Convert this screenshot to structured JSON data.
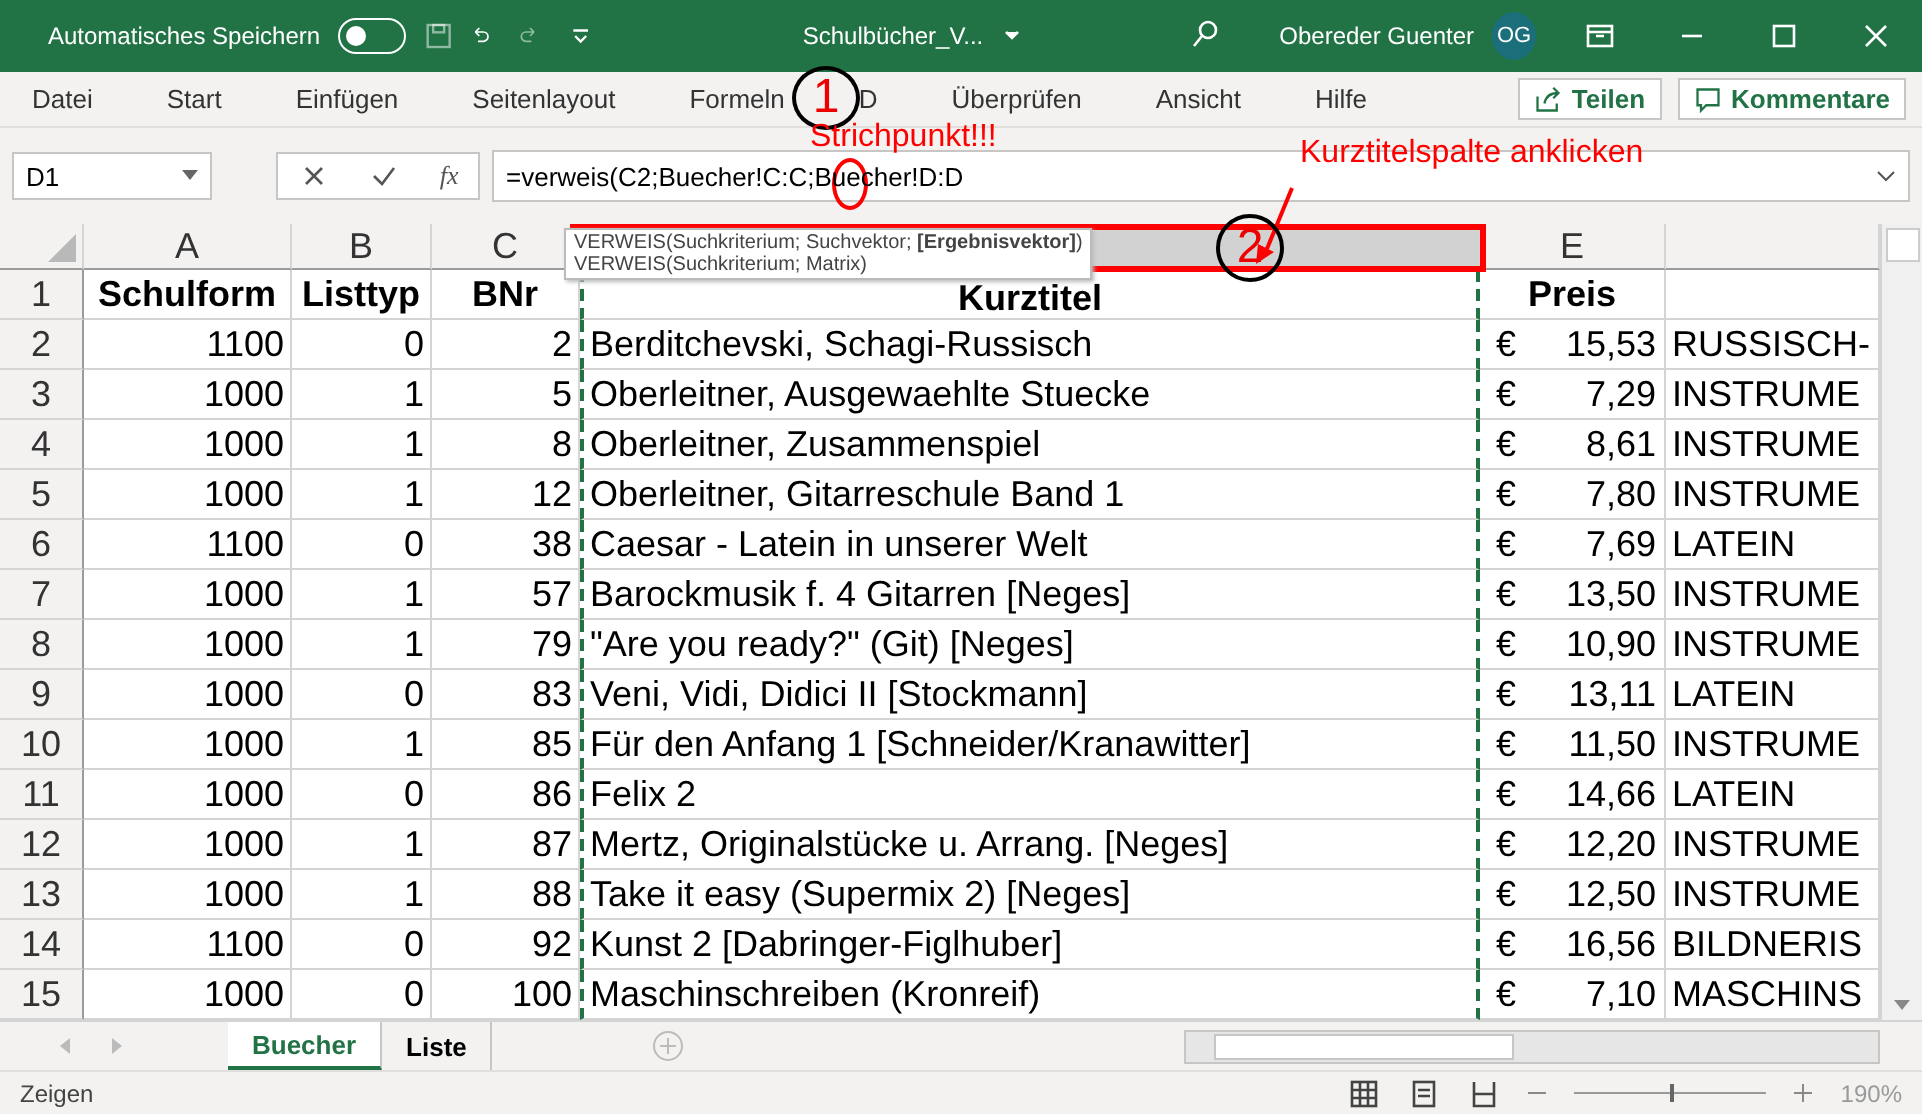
{
  "title_bar": {
    "autosave_label": "Automatisches Speichern",
    "autosave_on": false,
    "file_name": "Schulbücher_V...",
    "user_name": "Obereder Guenter",
    "user_initials": "OG"
  },
  "ribbon_tabs": [
    "Datei",
    "Start",
    "Einfügen",
    "Seitenlayout",
    "Formeln",
    "D",
    "Überprüfen",
    "Ansicht",
    "Hilfe"
  ],
  "ribbon_buttons": [
    "Teilen",
    "Kommentare"
  ],
  "name_box": "D1",
  "function_button": "fx",
  "formula": "=verweis(C2;Buecher!C:C;Buecher!D:D",
  "tooltip": [
    "VERWEIS(Suchkriterium; Suchvektor; **[Ergebnisvektor]**)",
    "VERWEIS(Suchkriterium; Matrix)"
  ],
  "column_headers": [
    {
      "label": "A",
      "selected": false
    },
    {
      "label": "B",
      "selected": false
    },
    {
      "label": "C",
      "selected": false
    },
    {
      "selected": true
    },
    {
      "label": "E",
      "selected": false
    },
    {
      "selected": false
    }
  ],
  "rows": [
    {
      "number": "1",
      "kind": "header",
      "schulform": "Schulform",
      "listtyp": "Listtyp",
      "bnr": "BNr",
      "kurztitel": "Kurztitel",
      "preis": "Preis"
    },
    {
      "number": "2",
      "kind": "data",
      "schulform": "1100",
      "listtyp": "0",
      "bnr": "2",
      "kurztitel": "Berditchevski, Schagi-Russisch",
      "currency": "€",
      "preis": "15,53",
      "fach": "RUSSISCH-"
    },
    {
      "number": "3",
      "kind": "data",
      "schulform": "1000",
      "listtyp": "1",
      "bnr": "5",
      "kurztitel": "Oberleitner, Ausgewaehlte Stuecke",
      "currency": "€",
      "preis": "7,29",
      "fach": "INSTRUME"
    },
    {
      "number": "4",
      "kind": "data",
      "schulform": "1000",
      "listtyp": "1",
      "bnr": "8",
      "kurztitel": "Oberleitner, Zusammenspiel",
      "currency": "€",
      "preis": "8,61",
      "fach": "INSTRUME"
    },
    {
      "number": "5",
      "kind": "data",
      "schulform": "1000",
      "listtyp": "1",
      "bnr": "12",
      "kurztitel": "Oberleitner, Gitarreschule Band 1",
      "currency": "€",
      "preis": "7,80",
      "fach": "INSTRUME"
    },
    {
      "number": "6",
      "kind": "data",
      "schulform": "1100",
      "listtyp": "0",
      "bnr": "38",
      "kurztitel": "Caesar - Latein in unserer Welt",
      "currency": "€",
      "preis": "7,69",
      "fach": "LATEIN"
    },
    {
      "number": "7",
      "kind": "data",
      "schulform": "1000",
      "listtyp": "1",
      "bnr": "57",
      "kurztitel": "Barockmusik f. 4 Gitarren [Neges]",
      "currency": "€",
      "preis": "13,50",
      "fach": "INSTRUME"
    },
    {
      "number": "8",
      "kind": "data",
      "schulform": "1000",
      "listtyp": "1",
      "bnr": "79",
      "kurztitel": "\"Are you ready?\" (Git) [Neges]",
      "currency": "€",
      "preis": "10,90",
      "fach": "INSTRUME"
    },
    {
      "number": "9",
      "kind": "data",
      "schulform": "1000",
      "listtyp": "0",
      "bnr": "83",
      "kurztitel": "Veni, Vidi, Didici II [Stockmann]",
      "currency": "€",
      "preis": "13,11",
      "fach": "LATEIN"
    },
    {
      "number": "10",
      "kind": "data",
      "schulform": "1000",
      "listtyp": "1",
      "bnr": "85",
      "kurztitel": "Für den Anfang 1 [Schneider/Kranawitter]",
      "currency": "€",
      "preis": "11,50",
      "fach": "INSTRUME"
    },
    {
      "number": "11",
      "kind": "data",
      "schulform": "1000",
      "listtyp": "0",
      "bnr": "86",
      "kurztitel": "Felix 2",
      "currency": "€",
      "preis": "14,66",
      "fach": "LATEIN"
    },
    {
      "number": "12",
      "kind": "data",
      "schulform": "1000",
      "listtyp": "1",
      "bnr": "87",
      "kurztitel": "Mertz, Originalstücke u. Arrang. [Neges]",
      "currency": "€",
      "preis": "12,20",
      "fach": "INSTRUME"
    },
    {
      "number": "13",
      "kind": "data",
      "schulform": "1000",
      "listtyp": "1",
      "bnr": "88",
      "kurztitel": "Take it easy (Supermix 2) [Neges]",
      "currency": "€",
      "preis": "12,50",
      "fach": "INSTRUME"
    },
    {
      "number": "14",
      "kind": "data",
      "schulform": "1100",
      "listtyp": "0",
      "bnr": "92",
      "kurztitel": "Kunst 2 [Dabringer-Figlhuber]",
      "currency": "€",
      "preis": "16,56",
      "fach": "BILDNERIS"
    },
    {
      "number": "15",
      "kind": "data",
      "schulform": "1000",
      "listtyp": "0",
      "bnr": "100",
      "kurztitel": "Maschinschreiben (Kronreif)",
      "currency": "€",
      "preis": "7,10",
      "fach": "MASCHINS"
    }
  ],
  "sheet_tabs": [
    {
      "label": "Buecher",
      "selected": true
    },
    {
      "label": "Liste",
      "selected": false
    }
  ],
  "status_bar": {
    "text": "Zeigen",
    "zoom": "190%",
    "level": 0.5
  },
  "annotations": [
    {
      "kind": "circle",
      "text": "1"
    },
    {
      "kind": "note",
      "text": "Strichpunkt!!!"
    },
    {
      "kind": "ellipse"
    },
    {
      "kind": "note",
      "text": "Kurztitelspalte anklicken"
    },
    {
      "kind": "arrow"
    },
    {
      "kind": "frame"
    },
    {
      "kind": "circle",
      "text": "2"
    }
  ]
}
